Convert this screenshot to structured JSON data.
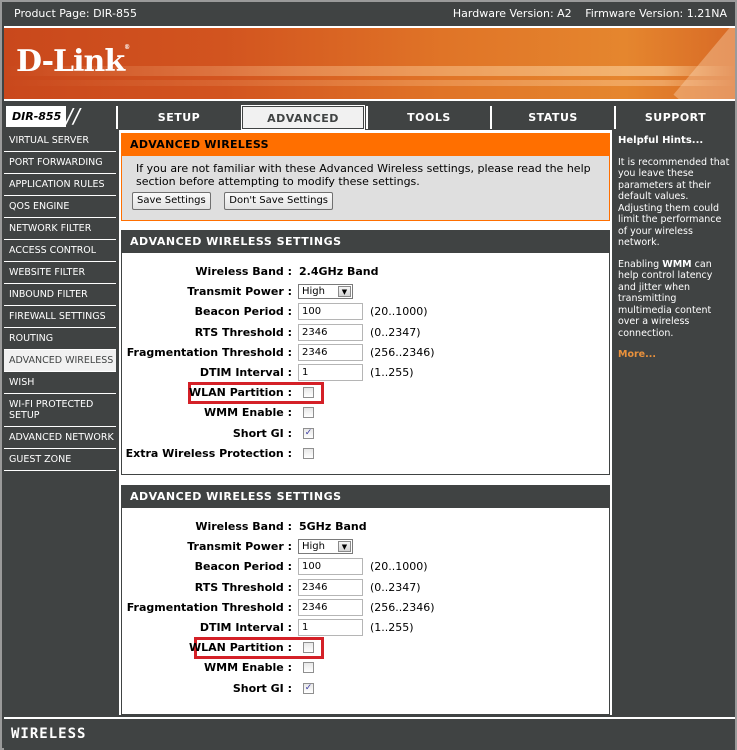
{
  "topbar": {
    "product": "Product Page: DIR-855",
    "hardware": "Hardware Version: A2",
    "firmware": "Firmware Version: 1.21NA"
  },
  "banner": {
    "logo": "D-Link",
    "trademark": "®"
  },
  "nav": {
    "model": "DIR-855",
    "tabs": [
      {
        "label": "SETUP",
        "active": false
      },
      {
        "label": "ADVANCED",
        "active": true
      },
      {
        "label": "TOOLS",
        "active": false
      },
      {
        "label": "STATUS",
        "active": false
      },
      {
        "label": "SUPPORT",
        "active": false
      }
    ]
  },
  "sidebar": {
    "items": [
      {
        "label": "VIRTUAL SERVER"
      },
      {
        "label": "PORT FORWARDING"
      },
      {
        "label": "APPLICATION RULES"
      },
      {
        "label": "QOS ENGINE"
      },
      {
        "label": "NETWORK FILTER"
      },
      {
        "label": "ACCESS CONTROL"
      },
      {
        "label": "WEBSITE FILTER"
      },
      {
        "label": "INBOUND FILTER"
      },
      {
        "label": "FIREWALL SETTINGS"
      },
      {
        "label": "ROUTING"
      },
      {
        "label": "ADVANCED WIRELESS",
        "active": true
      },
      {
        "label": "WISH"
      },
      {
        "label": "WI-FI PROTECTED SETUP"
      },
      {
        "label": "ADVANCED NETWORK"
      },
      {
        "label": "GUEST ZONE"
      }
    ]
  },
  "intro": {
    "title": "ADVANCED WIRELESS",
    "text": "If you are not familiar with these Advanced Wireless settings, please read the help section before attempting to modify these settings.",
    "save_label": "Save Settings",
    "dont_save_label": "Don't Save Settings"
  },
  "sections": [
    {
      "title": "ADVANCED WIRELESS SETTINGS",
      "wireless_band_label": "Wireless Band :",
      "wireless_band": "2.4GHz Band",
      "transmit_power_label": "Transmit Power :",
      "transmit_power": "High",
      "beacon_label": "Beacon Period :",
      "beacon": "100",
      "beacon_range": "(20..1000)",
      "rts_label": "RTS Threshold :",
      "rts": "2346",
      "rts_range": "(0..2347)",
      "frag_label": "Fragmentation Threshold :",
      "frag": "2346",
      "frag_range": "(256..2346)",
      "dtim_label": "DTIM Interval :",
      "dtim": "1",
      "dtim_range": "(1..255)",
      "wlan_partition_label": "WLAN Partition :",
      "wlan_partition": false,
      "wmm_label": "WMM Enable :",
      "wmm": false,
      "short_gi_label": "Short GI :",
      "short_gi": true,
      "extra_protection_label": "Extra Wireless Protection :",
      "extra_protection": false
    },
    {
      "title": "ADVANCED WIRELESS SETTINGS",
      "wireless_band_label": "Wireless Band :",
      "wireless_band": "5GHz Band",
      "transmit_power_label": "Transmit Power :",
      "transmit_power": "High",
      "beacon_label": "Beacon Period :",
      "beacon": "100",
      "beacon_range": "(20..1000)",
      "rts_label": "RTS Threshold :",
      "rts": "2346",
      "rts_range": "(0..2347)",
      "frag_label": "Fragmentation Threshold :",
      "frag": "2346",
      "frag_range": "(256..2346)",
      "dtim_label": "DTIM Interval :",
      "dtim": "1",
      "dtim_range": "(1..255)",
      "wlan_partition_label": "WLAN Partition :",
      "wlan_partition": false,
      "wmm_label": "WMM Enable :",
      "wmm": false,
      "short_gi_label": "Short GI :",
      "short_gi": true
    }
  ],
  "hints": {
    "title": "Helpful Hints...",
    "p1": "It is recommended that you leave these parameters at their default values. Adjusting them could limit the performance of your wireless network.",
    "p2_pre": "Enabling ",
    "p2_bold": "WMM",
    "p2_post": " can help control latency and jitter when transmitting multimedia content over a wireless connection.",
    "more": "More..."
  },
  "footer": {
    "label": "WIRELESS"
  },
  "colors": {
    "orange": "#ff6f00",
    "dark": "#404343",
    "highlight_red": "#d42027",
    "more_link": "#e9913c"
  }
}
